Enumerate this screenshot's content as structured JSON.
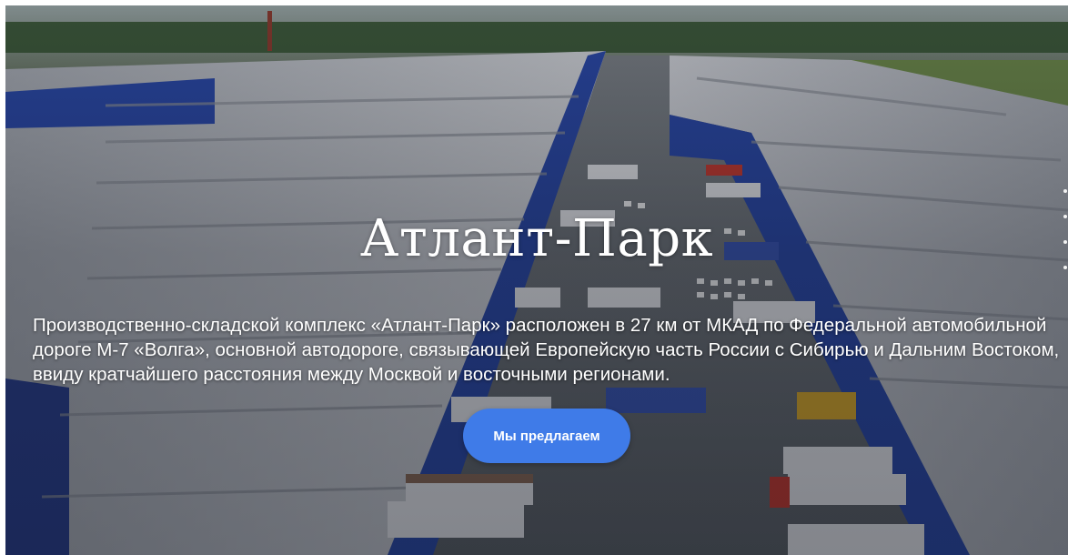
{
  "hero": {
    "title": "Атлант-Парк",
    "description": "Производственно-складской комплекс «Атлант-Парк» расположен в 27 км от МКАД по Федеральной автомобильной дороге М-7 «Волга», основной автодороге, связывающей Европейскую часть России с Сибирью и Дальним Востоком, ввиду кратчайшего расстояния между Москвой и восточными регионами.",
    "cta_label": "Мы предлагаем"
  },
  "colors": {
    "accent": "#3f7be8",
    "warehouse_blue": "#2b49a8",
    "roof_grey": "#b9bcc3"
  }
}
